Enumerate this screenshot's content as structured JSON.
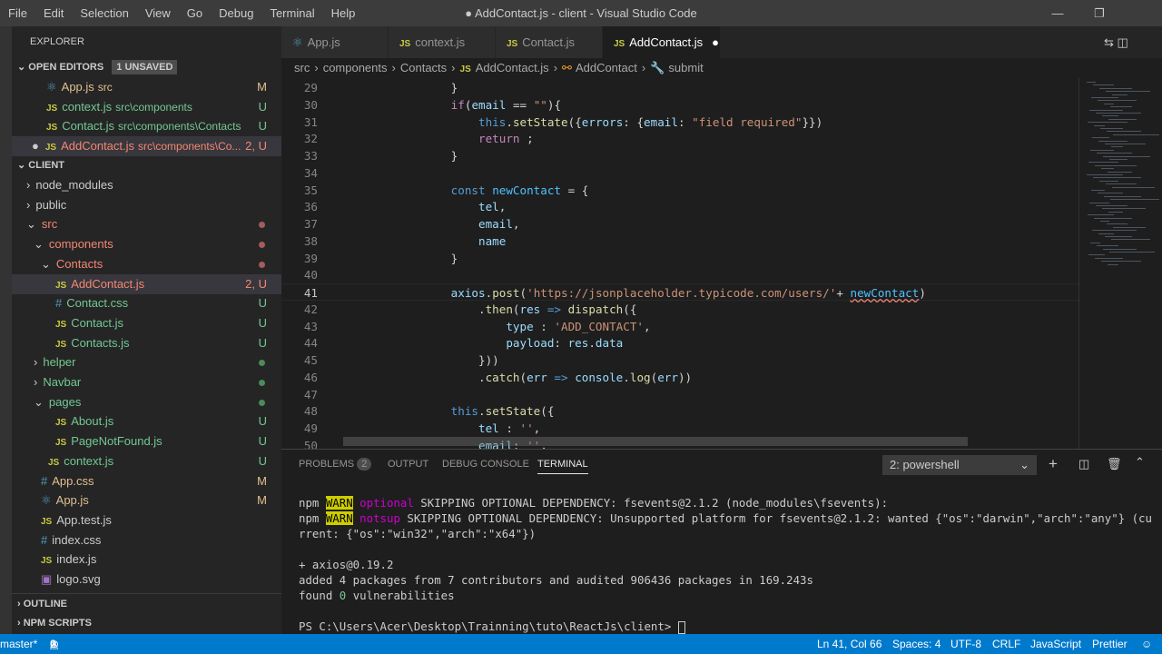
{
  "titlebar": {
    "menus": [
      "File",
      "Edit",
      "Selection",
      "View",
      "Go",
      "Debug",
      "Terminal",
      "Help"
    ],
    "title": "● AddContact.js - client - Visual Studio Code"
  },
  "sidebar": {
    "explorer": "EXPLORER",
    "open_editors": "OPEN EDITORS",
    "unsaved": "1 UNSAVED",
    "open": [
      {
        "name": "App.js",
        "path": "src",
        "badge": "M"
      },
      {
        "name": "context.js",
        "path": "src\\components",
        "badge": "U"
      },
      {
        "name": "Contact.js",
        "path": "src\\components\\Contacts",
        "badge": "U"
      },
      {
        "name": "AddContact.js",
        "path": "src\\components\\Co...",
        "badge": "2, U"
      }
    ],
    "client": "CLIENT",
    "tree": [
      {
        "name": "node_modules"
      },
      {
        "name": "public"
      },
      {
        "name": "src"
      },
      {
        "name": "components"
      },
      {
        "name": "Contacts"
      },
      {
        "name": "AddContact.js",
        "badge": "2, U"
      },
      {
        "name": "Contact.css",
        "badge": "U"
      },
      {
        "name": "Contact.js",
        "badge": "U"
      },
      {
        "name": "Contacts.js",
        "badge": "U"
      },
      {
        "name": "helper"
      },
      {
        "name": "Navbar"
      },
      {
        "name": "pages"
      },
      {
        "name": "About.js",
        "badge": "U"
      },
      {
        "name": "PageNotFound.js",
        "badge": "U"
      },
      {
        "name": "context.js",
        "badge": "U"
      },
      {
        "name": "App.css",
        "badge": "M"
      },
      {
        "name": "App.js",
        "badge": "M"
      },
      {
        "name": "App.test.js"
      },
      {
        "name": "index.css"
      },
      {
        "name": "index.js"
      },
      {
        "name": "logo.svg"
      }
    ],
    "outline": "OUTLINE",
    "npm": "NPM SCRIPTS"
  },
  "tabs": [
    "App.js",
    "context.js",
    "Contact.js",
    "AddContact.js"
  ],
  "breadcrumb": [
    "src",
    "components",
    "Contacts",
    "AddContact.js",
    "AddContact",
    "submit"
  ],
  "code": [
    {
      "n": "29",
      "t": [
        [
          "        }",
          "p"
        ]
      ]
    },
    {
      "n": "30",
      "t": [
        [
          "        ",
          "p"
        ],
        [
          "if",
          "k"
        ],
        [
          "(",
          "p"
        ],
        [
          "email",
          "v"
        ],
        [
          " == ",
          "p"
        ],
        [
          "\"\"",
          "s"
        ],
        [
          "){",
          "p"
        ]
      ]
    },
    {
      "n": "31",
      "t": [
        [
          "            ",
          "p"
        ],
        [
          "this",
          "kw"
        ],
        [
          ".",
          "p"
        ],
        [
          "setState",
          "f"
        ],
        [
          "({",
          "p"
        ],
        [
          "errors",
          "v"
        ],
        [
          ": {",
          "p"
        ],
        [
          "email",
          "v"
        ],
        [
          ": ",
          "p"
        ],
        [
          "\"field required\"",
          "s"
        ],
        [
          "}})",
          "p"
        ]
      ]
    },
    {
      "n": "32",
      "t": [
        [
          "            ",
          "p"
        ],
        [
          "return",
          "k"
        ],
        [
          " ;",
          "p"
        ]
      ]
    },
    {
      "n": "33",
      "t": [
        [
          "        }",
          "p"
        ]
      ]
    },
    {
      "n": "34",
      "t": [
        [
          "",
          "p"
        ]
      ]
    },
    {
      "n": "35",
      "t": [
        [
          "        ",
          "p"
        ],
        [
          "const",
          "kw"
        ],
        [
          " ",
          "p"
        ],
        [
          "newContact",
          "c"
        ],
        [
          " = {",
          "p"
        ]
      ]
    },
    {
      "n": "36",
      "t": [
        [
          "            ",
          "p"
        ],
        [
          "tel",
          "v"
        ],
        [
          ",",
          "p"
        ]
      ]
    },
    {
      "n": "37",
      "t": [
        [
          "            ",
          "p"
        ],
        [
          "email",
          "v"
        ],
        [
          ",",
          "p"
        ]
      ]
    },
    {
      "n": "38",
      "t": [
        [
          "            ",
          "p"
        ],
        [
          "name",
          "v"
        ]
      ]
    },
    {
      "n": "39",
      "t": [
        [
          "        }",
          "p"
        ]
      ]
    },
    {
      "n": "40",
      "t": [
        [
          "",
          "p"
        ]
      ]
    },
    {
      "n": "41",
      "t": [
        [
          "        ",
          "p"
        ],
        [
          "axios",
          "v"
        ],
        [
          ".",
          "p"
        ],
        [
          "post",
          "f"
        ],
        [
          "(",
          "p"
        ],
        [
          "'https://jsonplaceholder.typicode.com/users/'",
          "s"
        ],
        [
          "+ ",
          "p"
        ],
        [
          "newContact",
          "c"
        ],
        [
          ")",
          "p"
        ]
      ]
    },
    {
      "n": "42",
      "t": [
        [
          "            .",
          "p"
        ],
        [
          "then",
          "f"
        ],
        [
          "(",
          "p"
        ],
        [
          "res",
          "v"
        ],
        [
          " => ",
          "kw"
        ],
        [
          "dispatch",
          "f"
        ],
        [
          "({",
          "p"
        ]
      ]
    },
    {
      "n": "43",
      "t": [
        [
          "                ",
          "p"
        ],
        [
          "type",
          "v"
        ],
        [
          " : ",
          "p"
        ],
        [
          "'ADD_CONTACT'",
          "s"
        ],
        [
          ",",
          "p"
        ]
      ]
    },
    {
      "n": "44",
      "t": [
        [
          "                ",
          "p"
        ],
        [
          "payload",
          "v"
        ],
        [
          ": ",
          "p"
        ],
        [
          "res",
          "v"
        ],
        [
          ".",
          "p"
        ],
        [
          "data",
          "v"
        ]
      ]
    },
    {
      "n": "45",
      "t": [
        [
          "            }))",
          "p"
        ]
      ]
    },
    {
      "n": "46",
      "t": [
        [
          "            .",
          "p"
        ],
        [
          "catch",
          "f"
        ],
        [
          "(",
          "p"
        ],
        [
          "err",
          "v"
        ],
        [
          " => ",
          "kw"
        ],
        [
          "console",
          "v"
        ],
        [
          ".",
          "p"
        ],
        [
          "log",
          "f"
        ],
        [
          "(",
          "p"
        ],
        [
          "err",
          "v"
        ],
        [
          "))",
          "p"
        ]
      ]
    },
    {
      "n": "47",
      "t": [
        [
          "",
          "p"
        ]
      ]
    },
    {
      "n": "48",
      "t": [
        [
          "        ",
          "p"
        ],
        [
          "this",
          "kw"
        ],
        [
          ".",
          "p"
        ],
        [
          "setState",
          "f"
        ],
        [
          "({",
          "p"
        ]
      ]
    },
    {
      "n": "49",
      "t": [
        [
          "            ",
          "p"
        ],
        [
          "tel",
          "v"
        ],
        [
          " : ",
          "p"
        ],
        [
          "''",
          "s"
        ],
        [
          ",",
          "p"
        ]
      ]
    },
    {
      "n": "50",
      "t": [
        [
          "            ",
          "p"
        ],
        [
          "email",
          "v"
        ],
        [
          ": ",
          "p"
        ],
        [
          "''",
          "s"
        ],
        [
          ",",
          "p"
        ]
      ]
    }
  ],
  "panel": {
    "tabs": [
      "PROBLEMS",
      "OUTPUT",
      "DEBUG CONSOLE",
      "TERMINAL"
    ],
    "problems_count": "2",
    "terminal_select": "2: powershell",
    "lines": [
      [
        [
          "npm ",
          "w"
        ],
        [
          "WARN",
          "warn"
        ],
        [
          " ",
          "w"
        ],
        [
          "optional",
          "mg"
        ],
        [
          " SKIPPING OPTIONAL DEPENDENCY: fsevents@2.1.2 (node_modules\\fsevents):",
          "w"
        ]
      ],
      [
        [
          "npm ",
          "w"
        ],
        [
          "WARN",
          "warn"
        ],
        [
          " ",
          "w"
        ],
        [
          "notsup",
          "mg"
        ],
        [
          " SKIPPING OPTIONAL DEPENDENCY: Unsupported platform for fsevents@2.1.2: wanted {\"os\":\"darwin\",\"arch\":\"any\"} (cu",
          "w"
        ]
      ],
      [
        [
          "rrent: {\"os\":\"win32\",\"arch\":\"x64\"})",
          "w"
        ]
      ],
      [
        [
          "",
          "w"
        ]
      ],
      [
        [
          "+ axios@0.19.2",
          "w"
        ]
      ],
      [
        [
          "added 4 packages from 7 contributors and audited 906436 packages in 169.243s",
          "w"
        ]
      ],
      [
        [
          "found ",
          "w"
        ],
        [
          "0",
          "g"
        ],
        [
          " vulnerabilities",
          "w"
        ]
      ],
      [
        [
          "",
          "w"
        ]
      ],
      [
        [
          "PS C:\\Users\\Acer\\Desktop\\Trainning\\tuto\\ReactJs\\client> ",
          "w"
        ]
      ]
    ]
  },
  "status": {
    "branch": "master*",
    "errors": "2",
    "warnings": "0",
    "position": "Ln 41, Col 66",
    "spaces": "Spaces: 4",
    "encoding": "UTF-8",
    "eol": "CRLF",
    "language": "JavaScript",
    "formatter": "Prettier"
  }
}
